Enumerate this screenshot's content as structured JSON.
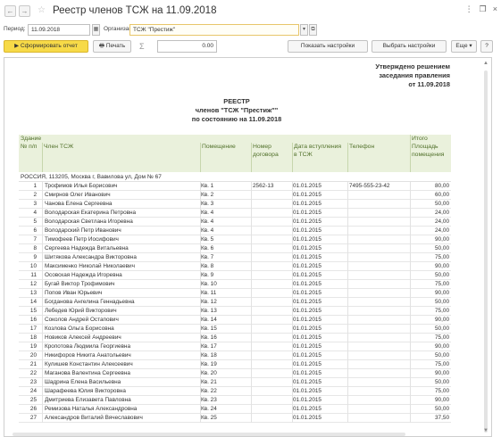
{
  "window": {
    "title": "Реестр членов ТСЖ на 11.09.2018",
    "back_glyph": "←",
    "forward_glyph": "→",
    "star_glyph": "☆",
    "menu_glyph": "⋮",
    "restore_glyph": "❐",
    "close_glyph": "×"
  },
  "filters": {
    "period_label": "Период:",
    "period_value": "11.09.2018",
    "calendar_glyph": "▦",
    "org_label": "Организация:",
    "org_value": "ТСЖ \"Престиж\"",
    "dropdown_glyph": "▾",
    "open_glyph": "⧉"
  },
  "toolbar": {
    "generate_label": "▶ Сформировать отчет",
    "print_label": "🖶 Печать",
    "sigma": "Σ",
    "sum_value": "0.00",
    "show_settings_label": "Показать настройки",
    "choose_settings_label": "Выбрать настройки",
    "more_label": "Еще ▾",
    "help_label": "?"
  },
  "report": {
    "approved_lines": [
      "Утверждено решением",
      "заседания правления",
      "от 11.09.2018"
    ],
    "heading_lines": [
      "РЕЕСТР",
      "членов \"ТСЖ \"Престиж\"\"",
      "по состоянию на 11.09.2018"
    ],
    "columns": {
      "building": "Здание",
      "total": "Итого",
      "num": "№ п/п",
      "member": "Член ТСЖ",
      "premises": "Помещение",
      "contract": "Номер договора",
      "date": "Дата вступления в ТСЖ",
      "phone": "Телефон",
      "area": "Площадь помещения"
    },
    "group_title": "РОССИЯ, 113205, Москва г, Вавилова ул, Дом № 67",
    "rows": [
      [
        "1",
        "Трофимов Илья Борисович",
        "Кв. 1",
        "2562-13",
        "01.01.2015",
        "7495-555-23-42",
        "80,00"
      ],
      [
        "2",
        "Смирнов Олег Иванович",
        "Кв. 2",
        "",
        "01.01.2015",
        "",
        "60,00"
      ],
      [
        "3",
        "Чанова Елена Сергеевна",
        "Кв. 3",
        "",
        "01.01.2015",
        "",
        "50,00"
      ],
      [
        "4",
        "Володарская Екатерина Петровна",
        "Кв. 4",
        "",
        "01.01.2015",
        "",
        "24,00"
      ],
      [
        "5",
        "Володарская Светлана Игоревна",
        "Кв. 4",
        "",
        "01.01.2015",
        "",
        "24,00"
      ],
      [
        "6",
        "Володарский Петр Иванович",
        "Кв. 4",
        "",
        "01.01.2015",
        "",
        "24,00"
      ],
      [
        "7",
        "Тимофеев Петр Иосифович",
        "Кв. 5",
        "",
        "01.01.2015",
        "",
        "90,00"
      ],
      [
        "8",
        "Сергеева Надежда Витальевна",
        "Кв. 6",
        "",
        "01.01.2015",
        "",
        "50,00"
      ],
      [
        "9",
        "Шитякова Александра Викторовна",
        "Кв. 7",
        "",
        "01.01.2015",
        "",
        "75,00"
      ],
      [
        "10",
        "Максименко Николай Николаевич",
        "Кв. 8",
        "",
        "01.01.2015",
        "",
        "90,00"
      ],
      [
        "11",
        "Осовская Надежда Игоревна",
        "Кв. 9",
        "",
        "01.01.2015",
        "",
        "50,00"
      ],
      [
        "12",
        "Бугай Виктор Трофимович",
        "Кв. 10",
        "",
        "01.01.2015",
        "",
        "75,00"
      ],
      [
        "13",
        "Попов Иван Юрьевич",
        "Кв. 11",
        "",
        "01.01.2015",
        "",
        "90,00"
      ],
      [
        "14",
        "Богданова Ангелина Геннадьевна",
        "Кв. 12",
        "",
        "01.01.2015",
        "",
        "50,00"
      ],
      [
        "15",
        "Лебедев Юрий Викторович",
        "Кв. 13",
        "",
        "01.01.2015",
        "",
        "75,00"
      ],
      [
        "16",
        "Соколов Андрей Остапович",
        "Кв. 14",
        "",
        "01.01.2015",
        "",
        "90,00"
      ],
      [
        "17",
        "Козлова Ольга Борисовна",
        "Кв. 15",
        "",
        "01.01.2015",
        "",
        "50,00"
      ],
      [
        "18",
        "Новиков Алексей Андреевич",
        "Кв. 16",
        "",
        "01.01.2015",
        "",
        "75,00"
      ],
      [
        "19",
        "Кропотова Людмила Георгиевна",
        "Кв. 17",
        "",
        "01.01.2015",
        "",
        "90,00"
      ],
      [
        "20",
        "Никифоров Никита Анатольевич",
        "Кв. 18",
        "",
        "01.01.2015",
        "",
        "50,00"
      ],
      [
        "21",
        "Кулишев Константин Алексеевич",
        "Кв. 19",
        "",
        "01.01.2015",
        "",
        "75,00"
      ],
      [
        "22",
        "Маганова Валентина Сергеевна",
        "Кв. 20",
        "",
        "01.01.2015",
        "",
        "90,00"
      ],
      [
        "23",
        "Шадрина Елена Васильевна",
        "Кв. 21",
        "",
        "01.01.2015",
        "",
        "50,00"
      ],
      [
        "24",
        "Шарафеева Юлия Викторовна",
        "Кв. 22",
        "",
        "01.01.2015",
        "",
        "75,00"
      ],
      [
        "25",
        "Дмитриева Елизавета Павловна",
        "Кв. 23",
        "",
        "01.01.2015",
        "",
        "90,00"
      ],
      [
        "26",
        "Ремизова Наталья Александровна",
        "Кв. 24",
        "",
        "01.01.2015",
        "",
        "50,00"
      ],
      [
        "27",
        "Александров Виталий Вячеславович",
        "Кв. 25",
        "",
        "01.01.2015",
        "",
        "37,50"
      ]
    ]
  },
  "scroll": {
    "up_glyph": "▲",
    "down_glyph": "▼"
  }
}
